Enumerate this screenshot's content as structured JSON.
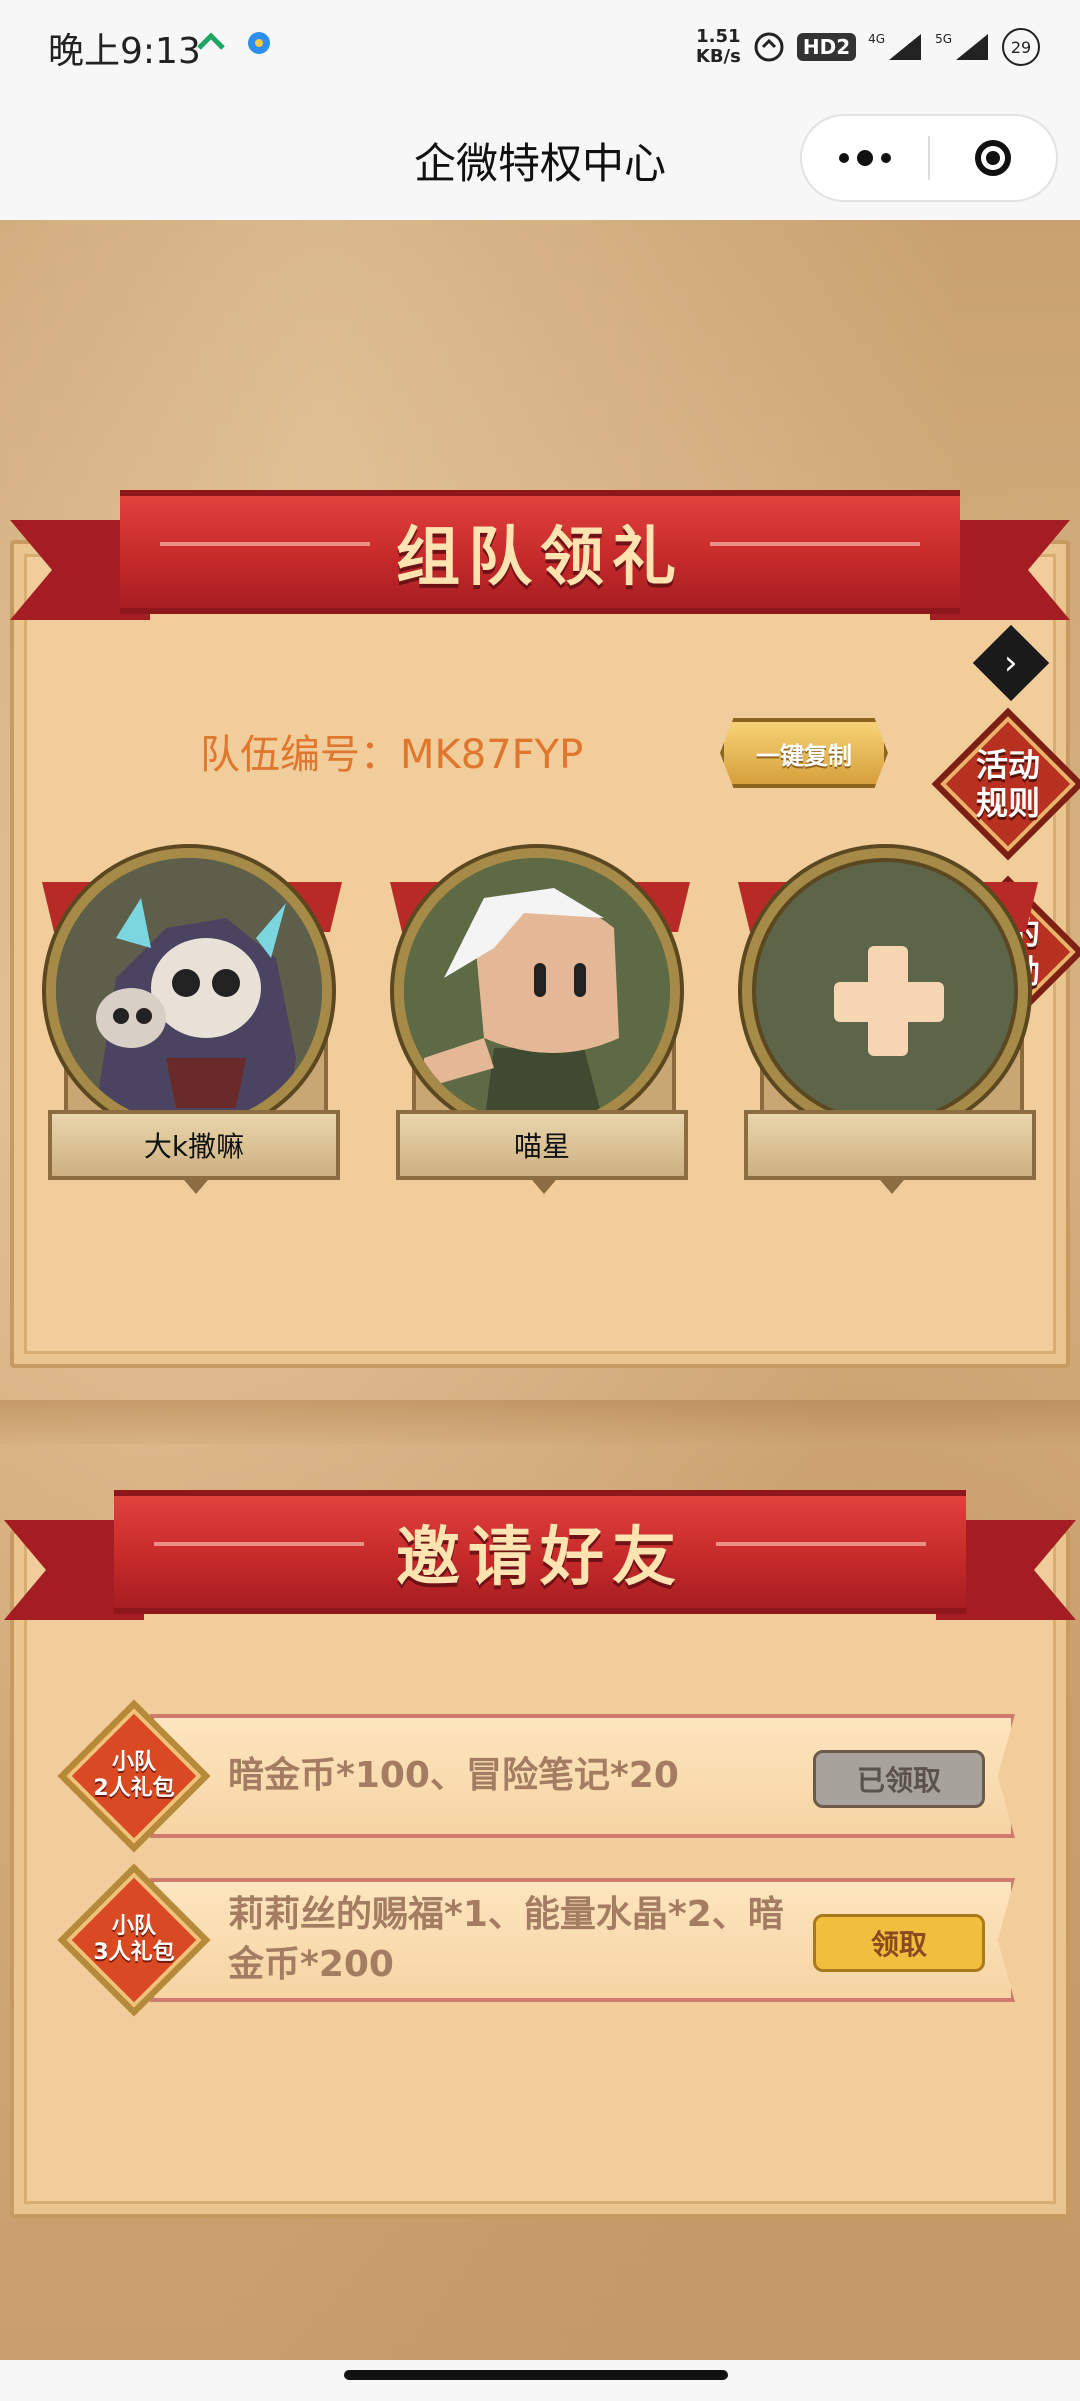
{
  "status_bar": {
    "time": "晚上9:13",
    "net_speed_value": "1.51",
    "net_speed_unit": "KB/s",
    "hd_badge": "HD2",
    "signal_1": "4G",
    "signal_2": "5G",
    "battery": "29"
  },
  "nav": {
    "title": "企微特权中心"
  },
  "team_section": {
    "banner_title": "组队领礼",
    "team_id_label": "队伍编号：",
    "team_id": "MK87FYP",
    "copy_button": "一键复制",
    "rules_button": "活动\n规则",
    "rewards_button": "我的\n奖励",
    "members": [
      {
        "name": "大k撒嘛",
        "avatar": "skull-warrior-avatar"
      },
      {
        "name": "喵星",
        "avatar": "white-hair-character-avatar"
      },
      {
        "name": "",
        "avatar": "add-member-plus"
      }
    ]
  },
  "invite_section": {
    "banner_title": "邀请好友",
    "rewards": [
      {
        "badge": "小队\n2人礼包",
        "desc": "暗金币*100、冒险笔记*20",
        "button": "已领取",
        "state": "claimed"
      },
      {
        "badge": "小队\n3人礼包",
        "desc": "莉莉丝的赐福*1、能量水晶*2、暗金币*200",
        "button": "领取",
        "state": "available"
      }
    ]
  },
  "colors": {
    "ribbon_red": "#c62a2a",
    "panel_bg": "#f0cd9b",
    "team_id_orange": "#e0772e",
    "claim_yellow": "#f2be3e",
    "claimed_gray": "#a8a29c"
  }
}
